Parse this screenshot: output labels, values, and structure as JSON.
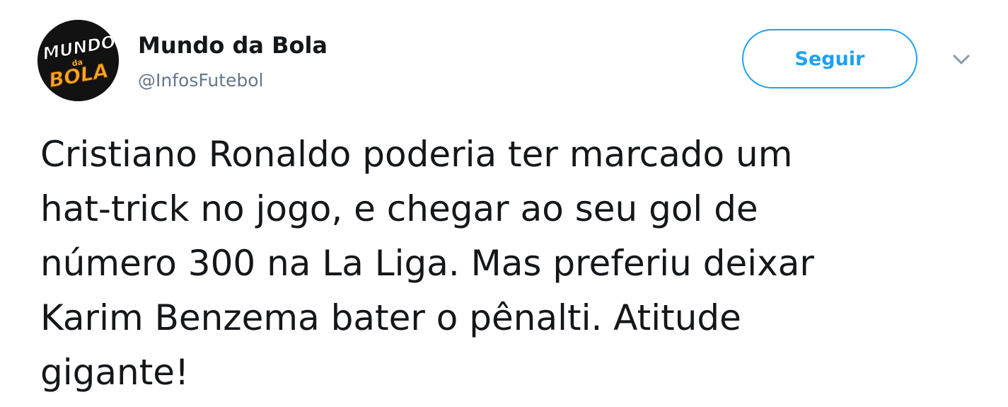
{
  "account": {
    "display_name": "Mundo da Bola",
    "handle": "@InfosFutebol",
    "avatar_logo_text": "MUNDO da BOLA"
  },
  "actions": {
    "follow_label": "Seguir",
    "more_icon": "chevron-down-icon"
  },
  "tweet": {
    "text": "Cristiano Ronaldo poderia ter marcado um\nhat-trick no jogo, e chegar ao seu gol de\nnúmero 300 na La Liga. Mas preferiu deixar\nKarim Benzema bater o pênalti. Atitude\ngigante!"
  },
  "colors": {
    "accent": "#1da1f2",
    "text": "#14171a",
    "secondary_text": "#657786",
    "avatar_bg": "#111111",
    "logo_orange": "#f5a623"
  }
}
